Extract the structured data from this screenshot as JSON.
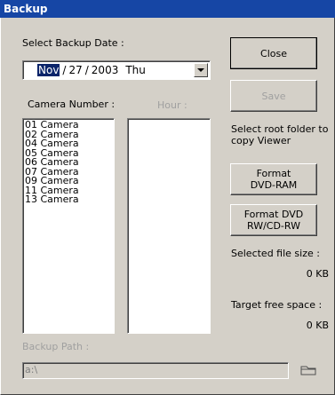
{
  "window": {
    "title": "Backup"
  },
  "date": {
    "label": "Select Backup Date :",
    "month": "Nov",
    "sep1": "/",
    "day": "27",
    "sep2": "/",
    "year": "2003",
    "weekday": "Thu"
  },
  "camera": {
    "label": "Camera Number :",
    "items": [
      "01 Camera",
      "02 Camera",
      "04 Camera",
      "05 Camera",
      "06 Camera",
      "07 Camera",
      "09 Camera",
      "11 Camera",
      "13 Camera"
    ]
  },
  "hour": {
    "label": "Hour :"
  },
  "buttons": {
    "close": "Close",
    "save": "Save",
    "format_ram_l1": "Format",
    "format_ram_l2": "DVD-RAM",
    "format_rw_l1": "Format DVD",
    "format_rw_l2": "RW/CD-RW"
  },
  "info": {
    "root_folder_l1": "Select root folder to",
    "root_folder_l2": "copy Viewer",
    "selected_size_label": "Selected file size :",
    "selected_size_value": "0 KB",
    "target_free_label": "Target free space :",
    "target_free_value": "0 KB"
  },
  "path": {
    "label": "Backup Path :",
    "value": "a:\\"
  }
}
